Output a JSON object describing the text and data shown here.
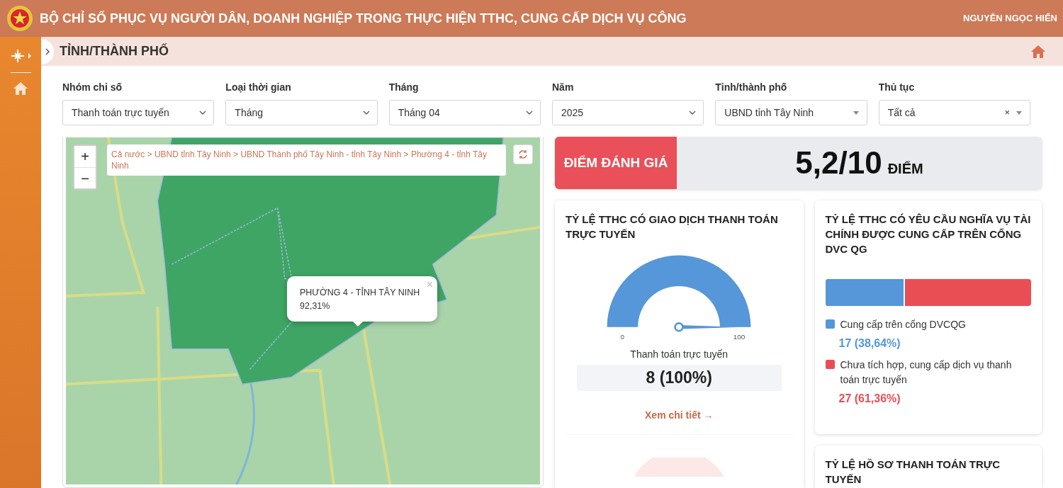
{
  "header": {
    "title": "BỘ CHỈ SỐ PHỤC VỤ NGƯỜI DÂN, DOANH NGHIỆP TRONG THỰC HIỆN TTHC, CUNG CẤP DỊCH VỤ CÔNG",
    "user": "NGUYỄN NGỌC HIỂN"
  },
  "page_title": "TỈNH/THÀNH PHỐ",
  "filters": [
    {
      "label": "Nhóm chỉ số",
      "value": "Thanh toán trực tuyến",
      "kind": "native"
    },
    {
      "label": "Loại thời gian",
      "value": "Tháng",
      "kind": "native"
    },
    {
      "label": "Tháng",
      "value": "Tháng 04",
      "kind": "native"
    },
    {
      "label": "Năm",
      "value": "2025",
      "kind": "native"
    },
    {
      "label": "Tỉnh/thành phố",
      "value": "UBND tỉnh Tây Ninh",
      "kind": "combo"
    },
    {
      "label": "Thủ tục",
      "value": "Tất cả",
      "kind": "combo",
      "clear": "×"
    }
  ],
  "map": {
    "zoom_in": "+",
    "zoom_out": "−",
    "breadcrumb": "Cả nước > UBND tỉnh Tây Ninh > UBND Thành phố Tây Ninh - tỉnh Tây Ninh > Phường 4 - tỉnh Tây Ninh",
    "popup": {
      "close": "×",
      "title": "PHƯỜNG 4 - TỈNH TÂY NINH",
      "value": "92,31%"
    }
  },
  "score": {
    "label": "ĐIỂM ĐÁNH GIÁ",
    "value": "5,2/10",
    "unit": "ĐIỂM"
  },
  "gauge_card": {
    "title": "TỶ LỆ TTHC CÓ GIAO DỊCH THANH TOÁN TRỰC TUYẾN",
    "min": "0",
    "max": "100",
    "level": 1,
    "caption": "Thanh toán trực tuyến",
    "value": "8 (100%)",
    "link": "Xem chi tiết →"
  },
  "share_card": {
    "title": "TỶ LỆ TTHC CÓ YÊU CẦU NGHĨA VỤ TÀI CHÍNH ĐƯỢC CUNG CẤP TRÊN CỔNG DVC QG",
    "segments": [
      {
        "label": "Cung cấp trên cổng DVCQG",
        "value": "17 (38,64%)",
        "color": "#5597d8",
        "level": 0.3864
      },
      {
        "label": "Chưa tích hợp, cung cấp dịch vụ thanh toán trực tuyến",
        "value": "27 (61,36%)",
        "color": "#e94e55"
      }
    ]
  },
  "third_card": {
    "title": "TỶ LỆ HỒ SƠ THANH TOÁN TRỰC TUYẾN"
  }
}
